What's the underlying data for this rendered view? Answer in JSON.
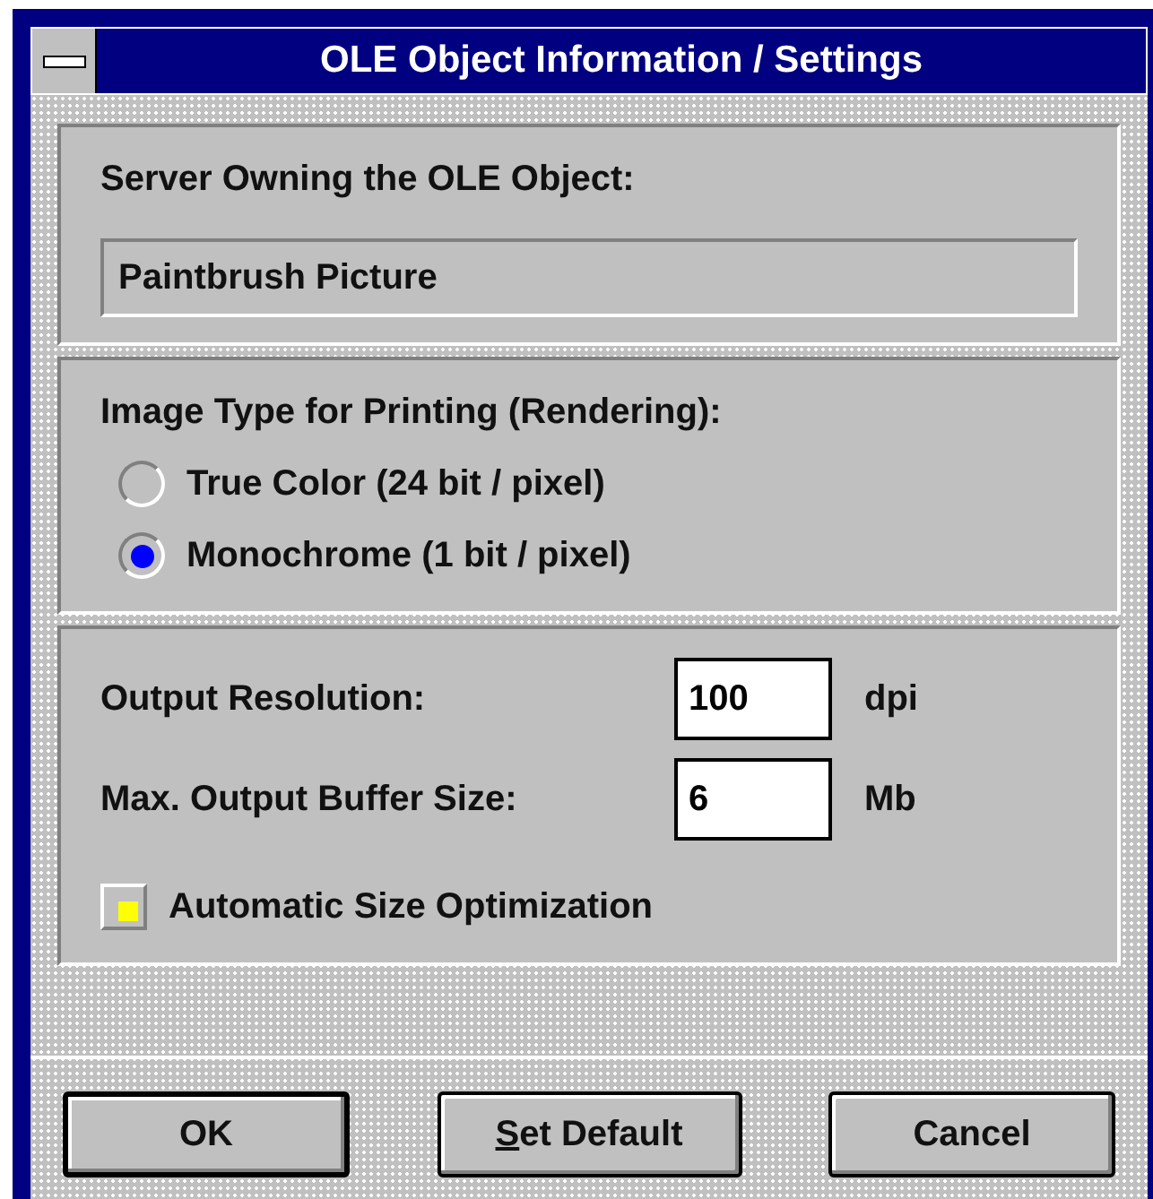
{
  "window": {
    "title": "OLE Object Information / Settings"
  },
  "server": {
    "label": "Server Owning the OLE Object:",
    "value": "Paintbrush Picture"
  },
  "image_type": {
    "label": "Image Type for Printing (Rendering):",
    "options": [
      {
        "label": "True Color (24 bit / pixel)",
        "selected": false
      },
      {
        "label": "Monochrome (1 bit / pixel)",
        "selected": true
      }
    ]
  },
  "output": {
    "fields": [
      {
        "label": "Output Resolution:",
        "value": "100",
        "unit": "dpi"
      },
      {
        "label": "Max. Output Buffer Size:",
        "value": "6",
        "unit": "Mb"
      }
    ],
    "checkbox": {
      "label": "Automatic Size Optimization",
      "checked": true
    }
  },
  "buttons": [
    {
      "label": "OK",
      "default": true,
      "underline_first": false
    },
    {
      "label": "Set Default",
      "default": false,
      "underline_first": true
    },
    {
      "label": "Cancel",
      "default": false,
      "underline_first": false
    }
  ]
}
